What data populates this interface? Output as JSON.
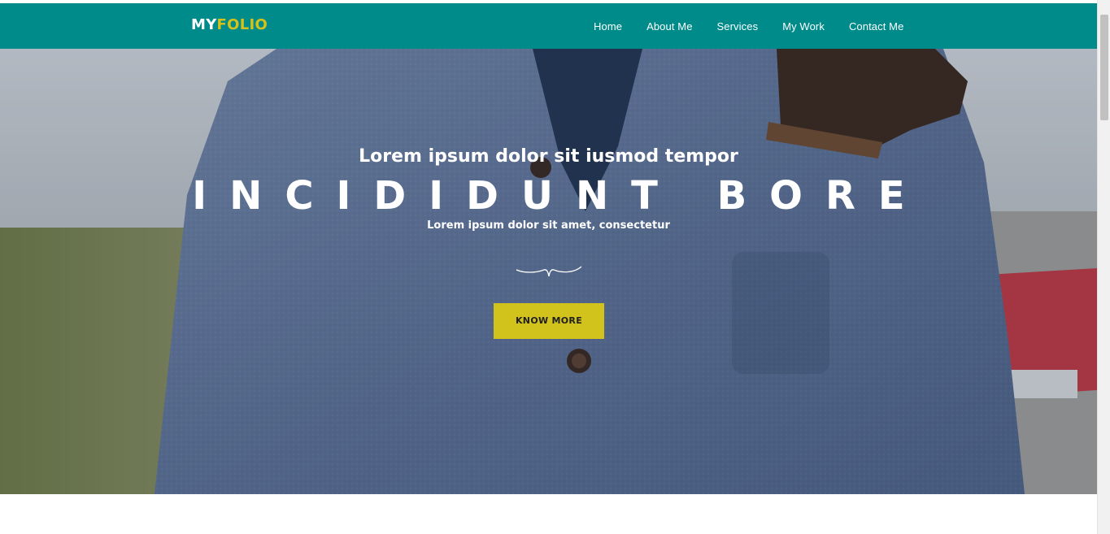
{
  "brand": {
    "part1": "MY",
    "part2": "FOLIO"
  },
  "nav": {
    "items": [
      {
        "label": "Home"
      },
      {
        "label": "About Me"
      },
      {
        "label": "Services"
      },
      {
        "label": "My Work"
      },
      {
        "label": "Contact Me"
      }
    ]
  },
  "hero": {
    "subtitle": "Lorem ipsum dolor sit iusmod tempor",
    "title": "INCIDIDUNT BORE",
    "tagline": "Lorem ipsum dolor sit amet, consectetur",
    "cta_label": "KNOW MORE"
  },
  "colors": {
    "navbar": "#008b8b",
    "accent": "#d1c21c",
    "text": "#ffffff"
  }
}
